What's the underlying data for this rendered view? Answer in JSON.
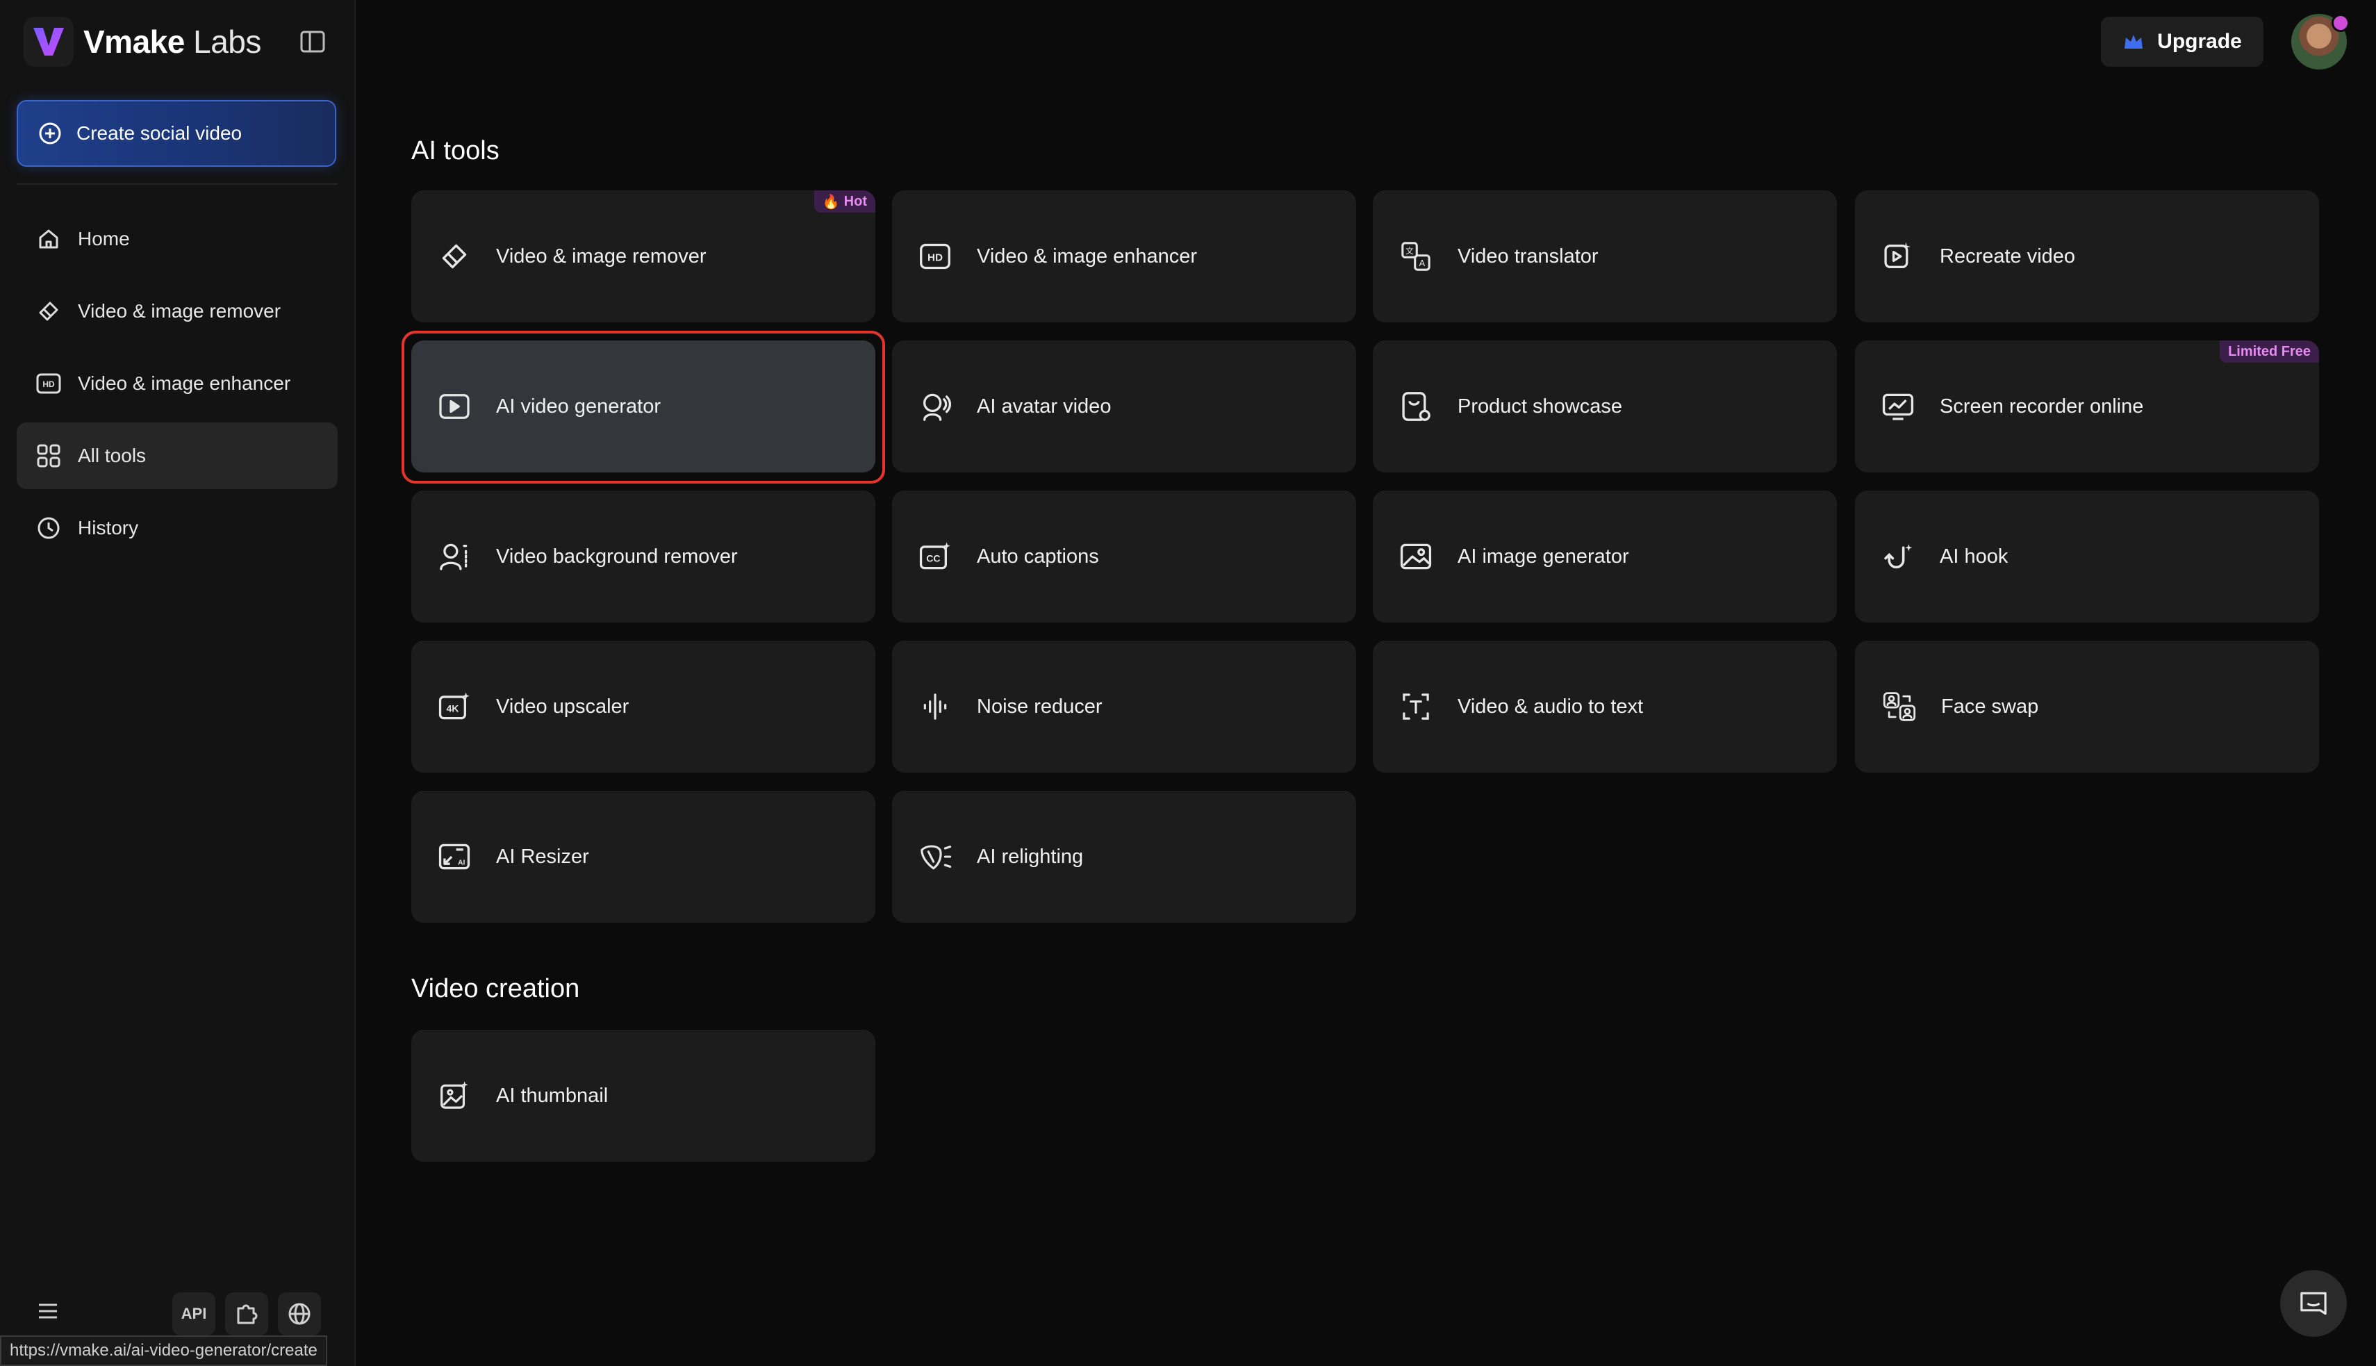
{
  "sidebar": {
    "brand_bold": "Vmake",
    "brand_light": "Labs",
    "create_label": "Create social video",
    "nav": [
      {
        "label": "Home",
        "icon": "home-icon"
      },
      {
        "label": "Video & image remover",
        "icon": "eraser-icon"
      },
      {
        "label": "Video & image enhancer",
        "icon": "hd-icon"
      },
      {
        "label": "All tools",
        "icon": "grid-icon"
      },
      {
        "label": "History",
        "icon": "clock-icon"
      }
    ],
    "api_label": "API"
  },
  "header": {
    "upgrade_label": "Upgrade"
  },
  "sections": {
    "ai_tools_title": "AI tools",
    "video_creation_title": "Video creation"
  },
  "tools": [
    {
      "label": "Video & image remover",
      "icon": "eraser-icon",
      "badge": "Hot"
    },
    {
      "label": "Video & image enhancer",
      "icon": "hd-icon"
    },
    {
      "label": "Video translator",
      "icon": "translate-icon"
    },
    {
      "label": "Recreate video",
      "icon": "recreate-icon"
    },
    {
      "label": "AI video generator",
      "icon": "play-icon",
      "selected": true
    },
    {
      "label": "AI avatar video",
      "icon": "avatar-icon"
    },
    {
      "label": "Product showcase",
      "icon": "product-icon"
    },
    {
      "label": "Screen recorder online",
      "icon": "screen-icon",
      "badge": "Limited Free"
    },
    {
      "label": "Video background remover",
      "icon": "person-bg-icon"
    },
    {
      "label": "Auto captions",
      "icon": "cc-icon"
    },
    {
      "label": "AI image generator",
      "icon": "image-icon"
    },
    {
      "label": "AI hook",
      "icon": "hook-icon"
    },
    {
      "label": "Video upscaler",
      "icon": "4k-icon"
    },
    {
      "label": "Noise reducer",
      "icon": "waveform-icon"
    },
    {
      "label": "Video & audio to text",
      "icon": "text-icon"
    },
    {
      "label": "Face swap",
      "icon": "face-swap-icon"
    },
    {
      "label": "AI Resizer",
      "icon": "resize-icon"
    },
    {
      "label": "AI relighting",
      "icon": "relight-icon"
    }
  ],
  "video_creation": [
    {
      "label": "AI thumbnail",
      "icon": "thumbnail-icon"
    }
  ],
  "status_bar_url": "https://vmake.ai/ai-video-generator/create",
  "colors": {
    "accent_blue": "#2f5bd1",
    "selection_red": "#e5352b",
    "badge_purple": "#e58df0"
  }
}
